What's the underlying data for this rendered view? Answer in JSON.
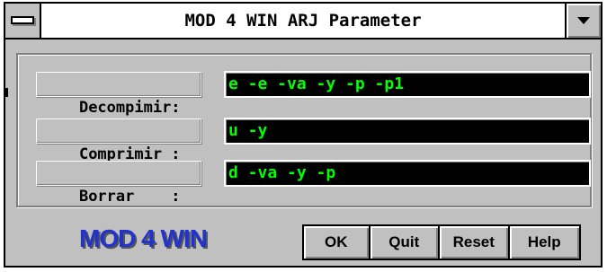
{
  "window": {
    "title": "MOD 4 WIN ARJ Parameter"
  },
  "rows": [
    {
      "label": "Decompimir:",
      "value": "e -e -va -y -p -p1"
    },
    {
      "label": "Comprimir :",
      "value": "u -y"
    },
    {
      "label": "Borrar    :",
      "value": "d -va -y -p"
    }
  ],
  "logo": {
    "text": "MOD 4 WIN"
  },
  "buttons": {
    "ok": "OK",
    "quit": "Quit",
    "reset": "Reset",
    "help": "Help"
  },
  "colors": {
    "field_bg": "#000000",
    "field_text": "#00ff00",
    "window_bg": "#c0c0c0",
    "logo": "#2233cc"
  }
}
